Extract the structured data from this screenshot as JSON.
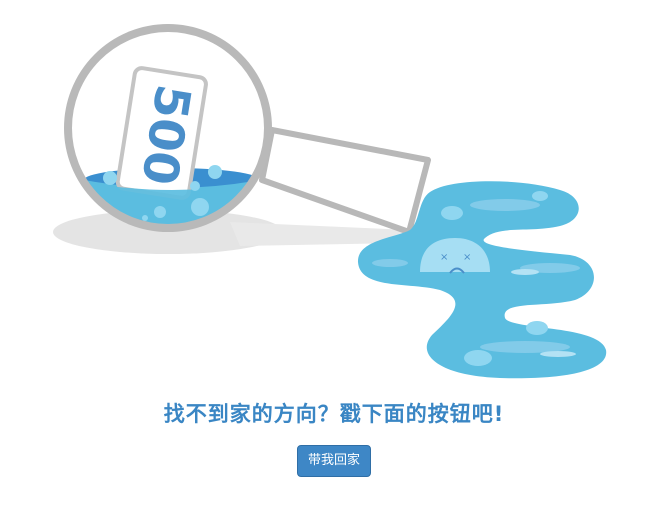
{
  "illustration": {
    "banknote_value": "500"
  },
  "message": {
    "text": "找不到家的方向？戳下面的按钮吧!"
  },
  "home_button": {
    "label": "带我回家"
  },
  "colors": {
    "accent_blue": "#3e87c6",
    "water_blue": "#5bbde0",
    "water_dark": "#3a8fd0",
    "lens_gray": "#b9b9b9"
  }
}
